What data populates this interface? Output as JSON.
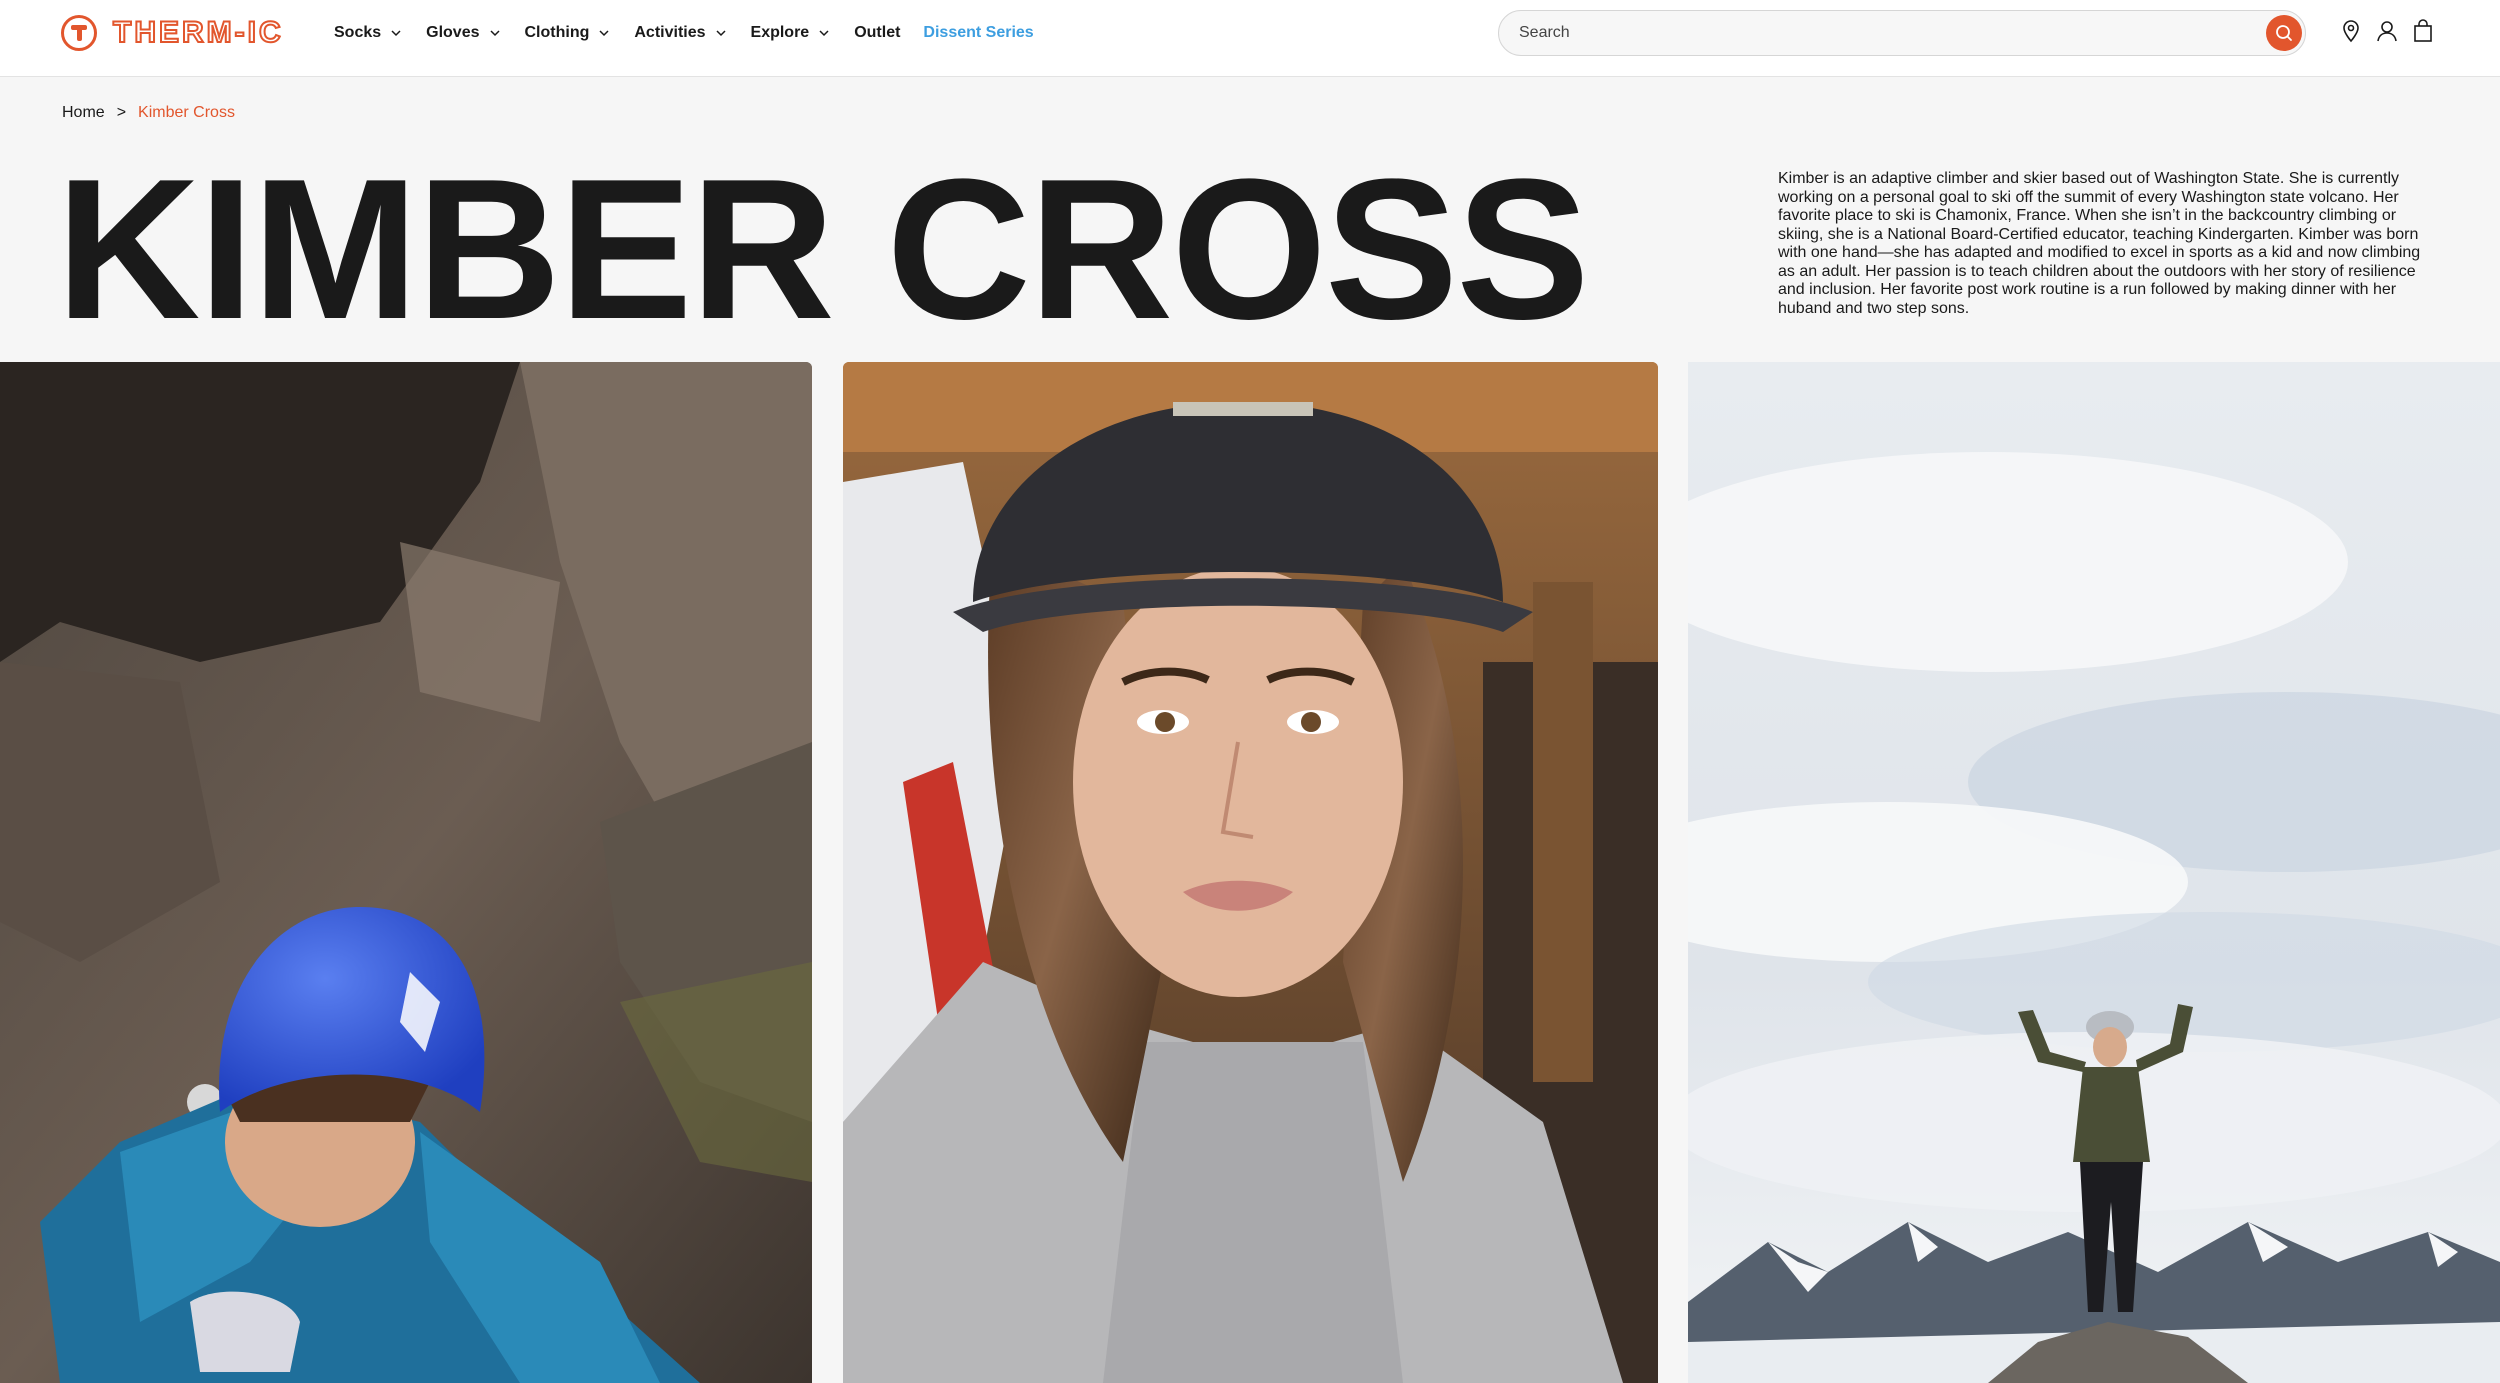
{
  "header": {
    "logo_text": "THERM-IC",
    "nav": [
      {
        "label": "Socks",
        "has_dropdown": true
      },
      {
        "label": "Gloves",
        "has_dropdown": true
      },
      {
        "label": "Clothing",
        "has_dropdown": true
      },
      {
        "label": "Activities",
        "has_dropdown": true
      },
      {
        "label": "Explore",
        "has_dropdown": true
      },
      {
        "label": "Outlet",
        "has_dropdown": false
      },
      {
        "label": "Dissent Series",
        "has_dropdown": false,
        "highlight": true
      }
    ],
    "search": {
      "placeholder": "Search",
      "value": ""
    },
    "icons": [
      "location-pin-icon",
      "account-icon",
      "cart-bag-icon",
      "search-icon"
    ],
    "accent_color": "#e2562d",
    "highlight_color": "#3d9ee0"
  },
  "breadcrumb": {
    "home": "Home",
    "separator": ">",
    "current": "Kimber Cross"
  },
  "hero": {
    "title": "KIMBER CROSS",
    "bio": "Kimber is an adaptive climber and skier based out of Washington State. She is currently working on a personal goal to ski off the summit of every Washington state volcano. Her favorite place to ski is Chamonix, France. When she isn’t in the backcountry climbing or skiing, she is a National Board-Certified educator, teaching Kindergarten. Kimber was born with one hand—she has adapted and modified to excel in sports as a kid and now climbing as an adult. Her passion is to teach children about the outdoors with her story of resilience and inclusion. Her favorite post work routine is a run followed by making dinner with her huband and two step sons."
  },
  "photos": [
    {
      "subject": "climber-in-blue-helmet-on-rock-face"
    },
    {
      "subject": "selfie-portrait-with-cap-and-backpack"
    },
    {
      "subject": "person-on-mountain-summit-under-cloudy-sky"
    }
  ]
}
